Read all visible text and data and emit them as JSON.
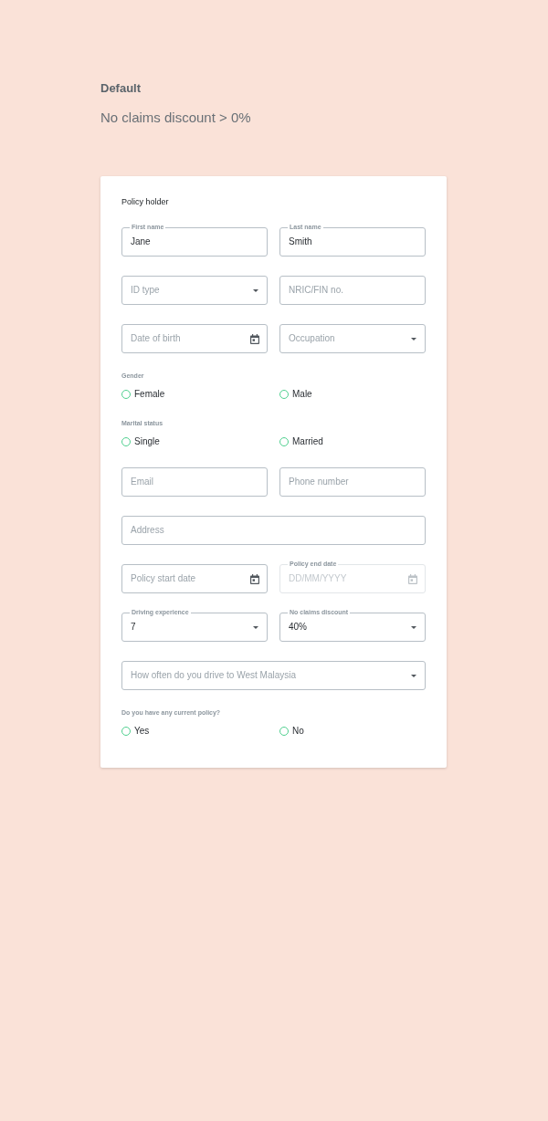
{
  "header": {
    "title": "Default",
    "subtitle": "No claims discount > 0%"
  },
  "form": {
    "title": "Policy holder",
    "rows": [
      {
        "kind": "fields",
        "fields": [
          {
            "kind": "text",
            "label": "First name",
            "value": "Jane",
            "disabled": false
          },
          {
            "kind": "text",
            "label": "Last name",
            "value": "Smith",
            "disabled": false
          }
        ]
      },
      {
        "kind": "fields",
        "fields": [
          {
            "kind": "select",
            "placeholder": "ID type",
            "disabled": false
          },
          {
            "kind": "text",
            "placeholder": "NRIC/FIN no.",
            "disabled": false
          }
        ]
      },
      {
        "kind": "fields",
        "fields": [
          {
            "kind": "date",
            "placeholder": "Date of birth",
            "disabled": false
          },
          {
            "kind": "select",
            "placeholder": "Occupation",
            "disabled": false
          }
        ]
      },
      {
        "kind": "radios",
        "label": "Gender",
        "options": [
          {
            "label": "Female",
            "selected": false
          },
          {
            "label": "Male",
            "selected": false
          }
        ]
      },
      {
        "kind": "radios",
        "label": "Marital status",
        "options": [
          {
            "label": "Single",
            "selected": false
          },
          {
            "label": "Married",
            "selected": false
          }
        ]
      },
      {
        "kind": "fields",
        "fields": [
          {
            "kind": "text",
            "placeholder": "Email",
            "disabled": false
          },
          {
            "kind": "text",
            "placeholder": "Phone number",
            "disabled": false
          }
        ]
      },
      {
        "kind": "fields",
        "fields": [
          {
            "kind": "text",
            "placeholder": "Address",
            "disabled": false
          }
        ]
      },
      {
        "kind": "fields",
        "fields": [
          {
            "kind": "date",
            "placeholder": "Policy start date",
            "disabled": false
          },
          {
            "kind": "date",
            "label": "Policy end date",
            "placeholder": "DD/MM/YYYY",
            "disabled": true
          }
        ]
      },
      {
        "kind": "fields",
        "fields": [
          {
            "kind": "select",
            "label": "Driving experience",
            "value": "7",
            "disabled": false
          },
          {
            "kind": "select",
            "label": "No claims discount",
            "value": "40%",
            "disabled": false
          }
        ]
      },
      {
        "kind": "fields",
        "fields": [
          {
            "kind": "select",
            "placeholder": "How often do you drive to West Malaysia",
            "disabled": false
          }
        ]
      },
      {
        "kind": "radios",
        "label": "Do you have any current policy?",
        "options": [
          {
            "label": "Yes",
            "selected": false
          },
          {
            "label": "No",
            "selected": false
          }
        ]
      }
    ]
  }
}
